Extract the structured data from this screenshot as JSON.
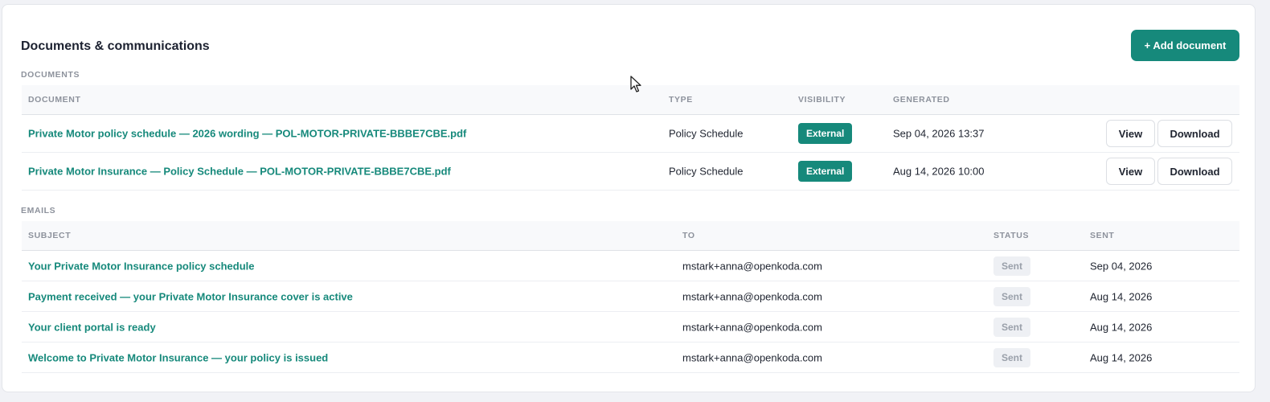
{
  "card": {
    "title": "Documents & communications",
    "add_button": "+ Add document"
  },
  "documents": {
    "section_label": "DOCUMENTS",
    "columns": {
      "document": "DOCUMENT",
      "type": "TYPE",
      "visibility": "VISIBILITY",
      "generated": "GENERATED"
    },
    "rows": [
      {
        "name": "Private Motor policy schedule — 2026 wording — POL-MOTOR-PRIVATE-BBBE7CBE.pdf",
        "type": "Policy Schedule",
        "visibility": "External",
        "generated": "Sep 04, 2026 13:37",
        "view_label": "View",
        "download_label": "Download"
      },
      {
        "name": "Private Motor Insurance — Policy Schedule — POL-MOTOR-PRIVATE-BBBE7CBE.pdf",
        "type": "Policy Schedule",
        "visibility": "External",
        "generated": "Aug 14, 2026 10:00",
        "view_label": "View",
        "download_label": "Download"
      }
    ]
  },
  "emails": {
    "section_label": "EMAILS",
    "columns": {
      "subject": "SUBJECT",
      "to": "TO",
      "status": "STATUS",
      "sent": "SENT"
    },
    "rows": [
      {
        "subject": "Your Private Motor Insurance policy schedule",
        "to": "mstark+anna@openkoda.com",
        "status": "Sent",
        "sent": "Sep 04, 2026"
      },
      {
        "subject": "Payment received — your Private Motor Insurance cover is active",
        "to": "mstark+anna@openkoda.com",
        "status": "Sent",
        "sent": "Aug 14, 2026"
      },
      {
        "subject": "Your client portal is ready",
        "to": "mstark+anna@openkoda.com",
        "status": "Sent",
        "sent": "Aug 14, 2026"
      },
      {
        "subject": "Welcome to Private Motor Insurance — your policy is issued",
        "to": "mstark+anna@openkoda.com",
        "status": "Sent",
        "sent": "Aug 14, 2026"
      }
    ]
  },
  "colors": {
    "accent": "#16897b",
    "badge_sent_bg": "#eef0f4",
    "page_bg": "#f1f2f6"
  },
  "icons": {
    "cursor": "mouse-pointer-icon"
  }
}
